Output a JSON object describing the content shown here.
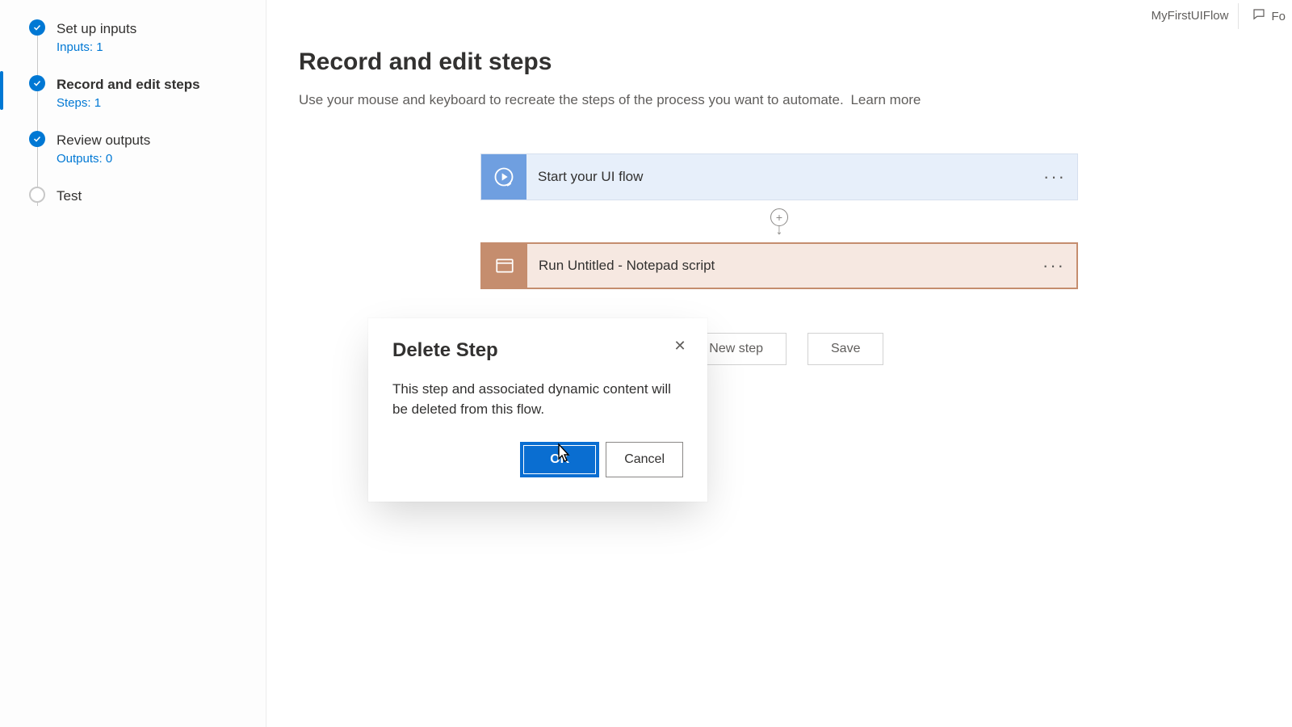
{
  "header": {
    "flow_name": "MyFirstUIFlow",
    "feedback_label": "Fo"
  },
  "sidebar": {
    "items": [
      {
        "title": "Set up inputs",
        "sub": "Inputs: 1",
        "active": false,
        "done": true
      },
      {
        "title": "Record and edit steps",
        "sub": "Steps: 1",
        "active": true,
        "done": true
      },
      {
        "title": "Review outputs",
        "sub": "Outputs: 0",
        "active": false,
        "done": true
      },
      {
        "title": "Test",
        "sub": "",
        "active": false,
        "done": false
      }
    ]
  },
  "main": {
    "title": "Record and edit steps",
    "description": "Use your mouse and keyboard to recreate the steps of the process you want to automate.",
    "learn_more": "Learn more"
  },
  "flow": {
    "start_label": "Start your UI flow",
    "run_label": "Run Untitled - Notepad script"
  },
  "actions": {
    "new_step": "+ New step",
    "save": "Save"
  },
  "dialog": {
    "title": "Delete Step",
    "body": "This step and associated dynamic content will be deleted from this flow.",
    "ok": "OK",
    "cancel": "Cancel"
  }
}
